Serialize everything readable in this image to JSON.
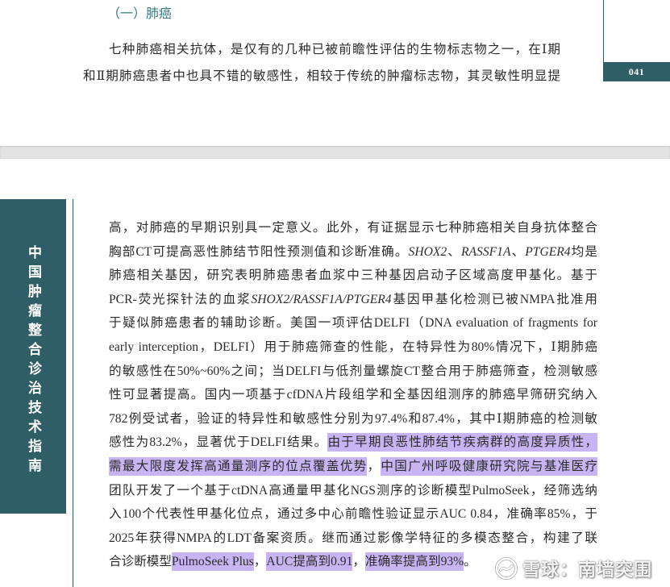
{
  "top_page": {
    "section_heading": "（一）肺癌",
    "lines": [
      "七种肺癌相关抗体，是仅有的几种已被前瞻性评估的生物标志物之一，在Ⅰ期",
      "和Ⅱ期肺癌患者中也具不错的敏感性，相较于传统的肿瘤标志物，其灵敏性明显提"
    ],
    "page_number": "041"
  },
  "bottom_page": {
    "side_tab_title": "中国肿瘤整合诊治技术指南",
    "lines": [
      [
        "高，对肺癌的早期识别具一定意义。此外，有证据显示七种肺癌相关自身抗体整合"
      ],
      [
        "胸部CT可提高恶性肺结节阳性预测值和诊断准确。",
        "SHOX2",
        "、",
        "RASSF1A",
        "、",
        "PTGER4",
        "均是"
      ],
      [
        "肺癌相关基因，研究表明肺癌患者血浆中三种基因启动子区域高度甲基化。基于"
      ],
      [
        "PCR-荧光探针法的血浆",
        "SHOX2/RASSF1A/PTGER4",
        "基因甲基化检测已被NMPA批准用"
      ],
      [
        "于疑似肺癌患者的辅助诊断。美国一项评估DELFI（DNA evaluation of fragments for"
      ],
      [
        "early interception，DELFI）用于肺癌筛查的性能，在特异性为80%情况下，Ⅰ期肺癌"
      ],
      [
        "的敏感性在50%~60%之间；当DELFI与低剂量螺旋CT整合用于肺癌筛查，检测敏感"
      ],
      [
        "性可显著提高。国内一项基于cfDNA片段组学和全基因组测序的肺癌早筛研究纳入"
      ],
      [
        "782例受试者，验证的特异性和敏感性分别为97.4%和87.4%，其中Ⅰ期肺癌的检测敏"
      ],
      [
        "感性为83.2%，显著优于DELFI结果。",
        "由于早期良恶性肺结节疾病群的高度异质性，"
      ],
      [
        "需最大限度发挥高通量测序的位点覆盖优势",
        "，",
        "中国广州呼吸健康研究院与基准医疗"
      ],
      [
        "团队开发了一个基于ctDNA高通量甲基化NGS测序的诊断模型PulmoSeek，经筛选纳"
      ],
      [
        "入100个代表性甲基化位点，通过多中心前瞻性验证显示AUC 0.84，准确率85%，于"
      ],
      [
        "2025年获得NMPA的LDT备案资质。继而通过影像学特征的多模态整合，构建了联"
      ],
      [
        "合诊断模型",
        "PulmoSeek Plus",
        "，",
        "AUC提高到0.91",
        "，",
        "准确率提高到93%",
        "。"
      ]
    ]
  },
  "watermark": {
    "text": "雪球：南墙突围",
    "icon": "xueqiu-logo-icon"
  },
  "colors": {
    "accent": "#2f5e66",
    "highlight": "#c9b4f3",
    "heading": "#3b7b88"
  }
}
